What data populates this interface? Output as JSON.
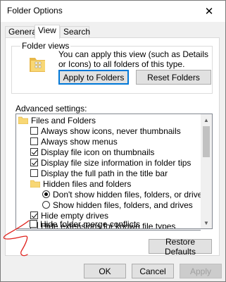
{
  "window": {
    "title": "Folder Options",
    "close_glyph": "✕"
  },
  "tabs": [
    {
      "label": "General",
      "active": false
    },
    {
      "label": "View",
      "active": true
    },
    {
      "label": "Search",
      "active": false
    }
  ],
  "folder_views": {
    "label": "Folder views",
    "description": "You can apply this view (such as Details or Icons) to all folders of this type.",
    "apply_label": "Apply to Folders",
    "reset_label": "Reset Folders"
  },
  "advanced": {
    "label": "Advanced settings:",
    "items": [
      {
        "type": "folder",
        "label": "Files and Folders"
      },
      {
        "type": "checkbox",
        "checked": false,
        "label": "Always show icons, never thumbnails"
      },
      {
        "type": "checkbox",
        "checked": false,
        "label": "Always show menus"
      },
      {
        "type": "checkbox",
        "checked": true,
        "label": "Display file icon on thumbnails"
      },
      {
        "type": "checkbox",
        "checked": true,
        "label": "Display file size information in folder tips"
      },
      {
        "type": "checkbox",
        "checked": false,
        "label": "Display the full path in the title bar"
      },
      {
        "type": "folder",
        "label": "Hidden files and folders"
      },
      {
        "type": "radio",
        "checked": true,
        "label": "Don't show hidden files, folders, or drives"
      },
      {
        "type": "radio",
        "checked": false,
        "label": "Show hidden files, folders, and drives"
      },
      {
        "type": "checkbox",
        "checked": true,
        "label": "Hide empty drives"
      },
      {
        "type": "checkbox",
        "checked": false,
        "label": "Hide extensions for known file types"
      },
      {
        "type": "checkbox",
        "checked": false,
        "label": "Hide folder merge conflicts"
      }
    ]
  },
  "restore_label": "Restore Defaults",
  "footer": {
    "ok_label": "OK",
    "cancel_label": "Cancel",
    "apply_label": "Apply"
  },
  "colors": {
    "focus_blue": "#0078d7",
    "folder_yellow": "#f8d775",
    "annotation_red": "#e0201b"
  }
}
